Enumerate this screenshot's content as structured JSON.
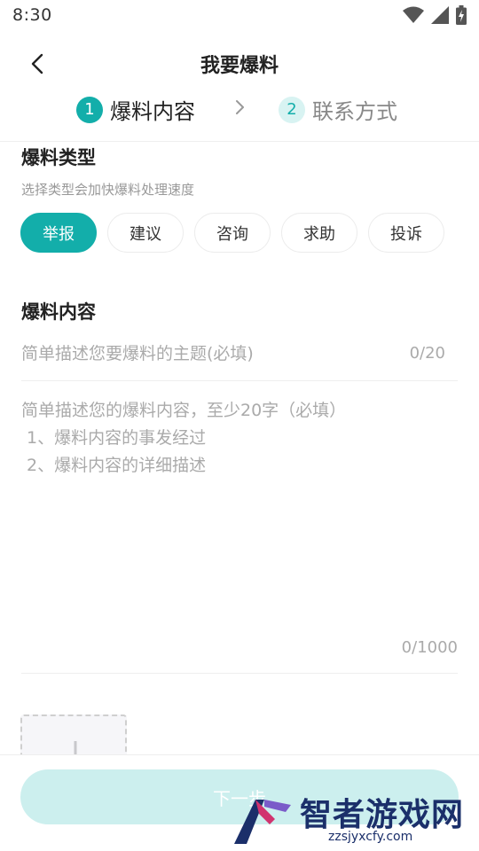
{
  "status_bar": {
    "time": "8:30",
    "icons": [
      "wifi-icon",
      "signal-icon",
      "battery-icon"
    ]
  },
  "nav": {
    "back_icon": "chevron-left-icon",
    "title": "我要爆料"
  },
  "steps": [
    {
      "number": "1",
      "label": "爆料内容",
      "active": true
    },
    {
      "number": "2",
      "label": "联系方式",
      "active": false
    }
  ],
  "type_section": {
    "title": "爆料类型",
    "hint": "选择类型会加快爆料处理速度",
    "options": [
      "举报",
      "建议",
      "咨询",
      "求助",
      "投诉"
    ],
    "selected": "举报"
  },
  "content_section": {
    "title": "爆料内容",
    "subject_placeholder": "简单描述您要爆料的主题(必填)",
    "subject_value": "",
    "subject_count": "0/20",
    "desc_placeholder": "简单描述您的爆料内容，至少20字（必填）\n 1、爆料内容的事发经过\n 2、爆料内容的详细描述",
    "desc_value": "",
    "desc_count": "0/1000"
  },
  "upload": {
    "icon": "plus-icon"
  },
  "footer": {
    "next_label": "下一步"
  },
  "watermark": {
    "name": "智者游戏网",
    "url": "zzsjyxcfy.com"
  },
  "colors": {
    "accent": "#13aeaa",
    "accent_light": "#d8f3f2",
    "button_disabled": "#ccefee"
  }
}
